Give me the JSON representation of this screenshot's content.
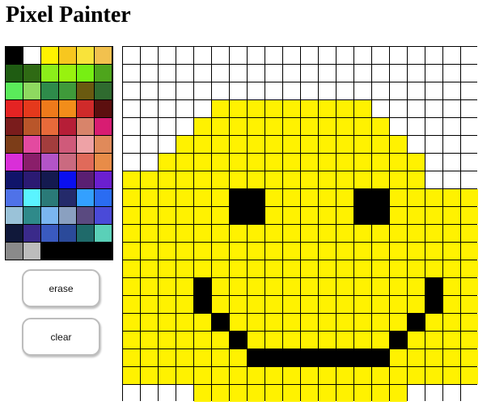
{
  "title": "Pixel Painter",
  "palette": {
    "colors": [
      "#000000",
      "#ffffff",
      "#fff200",
      "#f7c71f",
      "#f9e33a",
      "#f2c14e",
      "#1f5c12",
      "#2f6a14",
      "#8bee1a",
      "#98f20f",
      "#77ef13",
      "#4ea51c",
      "#5aeb5a",
      "#8ed960",
      "#2e8b4a",
      "#3f9a3a",
      "#6a5a10",
      "#2f6b2f",
      "#e42323",
      "#e5391c",
      "#ef7a1b",
      "#f28d1a",
      "#cf2a2a",
      "#5c0f0f",
      "#7a1c1c",
      "#b9562a",
      "#e86a3a",
      "#b61e37",
      "#d8846a",
      "#d81c72",
      "#7c3d18",
      "#e34aa0",
      "#a33d3d",
      "#cf5a7a",
      "#eea2a6",
      "#e08a5a",
      "#d92fd8",
      "#8a1e6a",
      "#b354c8",
      "#ca6a80",
      "#e06a5a",
      "#e88c48",
      "#10146a",
      "#2b1a72",
      "#141a50",
      "#0a0ff0",
      "#5a1f72",
      "#6b1fd0",
      "#4f72e8",
      "#5af4ff",
      "#2a7a78",
      "#242a6a",
      "#33a0ff",
      "#2a6cf2",
      "#9ac2d8",
      "#2f8a8a",
      "#7ab6f0",
      "#8aa0c0",
      "#5a4a80",
      "#4a4ad8",
      "#10183a",
      "#3a2a8a",
      "#3a5ac0",
      "#2b4a9a",
      "#1f6a6a",
      "#5ad0b8",
      "#8a8a8a",
      "#bcbcbc"
    ]
  },
  "buttons": {
    "erase_label": "erase",
    "clear_label": "clear"
  },
  "canvas": {
    "columns": 20,
    "rows": 20,
    "background_color": "#ffffff",
    "fill_color": "#fff200",
    "ink_color": "#000000",
    "pixels": [
      "....................",
      "....................",
      "....................",
      ".....YYYYYYYYY......",
      "....YYYYYYYYYYY.....",
      "...YYYYYYYYYYYYY....",
      "..YYYYYYYYYYYYYYY...",
      "YYYYYYYYYYYYYYYYY...",
      "YYYYYYKKYYYYYKKYYYYY",
      "YYYYYYKKYYYYYKKYYYYY",
      "YYYYYYYYYYYYYYYYYYYY",
      "YYYYYYYYYYYYYYYYYYYY",
      "YYYYYYYYYYYYYYYYYYYY",
      "YYYYKYYYYYYYYYYYYKYY",
      "YYYYKYYYYYYYYYYYYKYY",
      "YYYYYKYYYYYYYYYYKYYY",
      "YYYYYYKYYYYYYYYKYYYY",
      "YYYYYYYKKKKKKKKYYYYY",
      "YYYYYYYYYYYYYYYYYYYY",
      "....YYYYYYYYYYYY...."
    ]
  }
}
